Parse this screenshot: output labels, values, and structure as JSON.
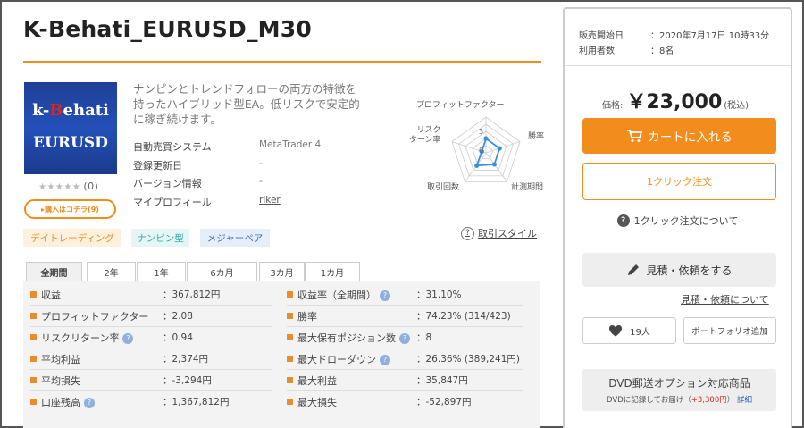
{
  "product": {
    "title": "K-Behati_EURUSD_M30",
    "image_line1_a": "k-",
    "image_line1_b": "B",
    "image_line1_c": "ehati",
    "image_line2": "EURUSD",
    "stars": "★★★★★",
    "review_count": "(0)",
    "buyers_button": "▸購入はコチラ(9)",
    "description": "ナンピンとトレンドフォローの両方の特徴を持ったハイブリッド型EA。低リスクで安定的に稼ぎ続けます。",
    "info": [
      {
        "label": "自動売買システム",
        "value": "MetaTrader 4"
      },
      {
        "label": "登録更新日",
        "value": "-"
      },
      {
        "label": "バージョン情報",
        "value": "-"
      },
      {
        "label": "マイプロフィール",
        "value": "riker"
      }
    ]
  },
  "radar": {
    "labels": {
      "profit_factor": "プロフィットファクター",
      "win_rate": "勝率",
      "period": "計測期間",
      "trades": "取引回数",
      "risk_return": "リスク\nターン率"
    },
    "scale_values": [
      "3",
      "0"
    ],
    "scores": [
      2,
      2,
      2,
      2.2,
      0.6
    ],
    "scale_max": 5
  },
  "tags": [
    "デイトレーディング",
    "ナンピン型",
    "メジャーペア"
  ],
  "trade_style_link": "取引スタイル",
  "tabs": [
    "全期間",
    "2年",
    "1年",
    "6カ月",
    "3カ月",
    "1カ月"
  ],
  "active_tab": "全期間",
  "stats_left": [
    {
      "label": "収益",
      "value": "：367,812円",
      "hint": false
    },
    {
      "label": "プロフィットファクター",
      "value": "：2.08",
      "hint": false
    },
    {
      "label": "リスクリターン率",
      "value": "：0.94",
      "hint": true
    },
    {
      "label": "平均利益",
      "value": "：2,374円",
      "hint": false
    },
    {
      "label": "平均損失",
      "value": "：-3,294円",
      "hint": false
    },
    {
      "label": "口座残高",
      "value": "：1,367,812円",
      "hint": true
    }
  ],
  "stats_right": [
    {
      "label": "収益率（全期間）",
      "value": "：31.10%",
      "hint": true
    },
    {
      "label": "勝率",
      "value": "：74.23% (314/423)",
      "hint": false
    },
    {
      "label": "最大保有ポジション数",
      "value": "：8",
      "hint": true
    },
    {
      "label": "最大ドローダウン",
      "value": "：26.36% (389,241円)",
      "hint": true
    },
    {
      "label": "最大利益",
      "value": "：35,847円",
      "hint": false
    },
    {
      "label": "最大損失",
      "value": "：-52,897円",
      "hint": false
    }
  ],
  "side": {
    "release_label": "販売開始日",
    "release_value": "：2020年7月17日 10時33分",
    "users_label": "利用者数",
    "users_value": "：8名",
    "price_label": "価格:",
    "price_value": "￥23,000",
    "price_tax": "(税込)",
    "cart_button": "カートに入れる",
    "oneclick_button": "1クリック注文",
    "about_oneclick": "1クリック注文について",
    "quote_button": "見積・依頼をする",
    "quote_link": "見積・依頼について",
    "favorites_count": "19人",
    "portfolio_button": "ポートフォリオ追加",
    "dvd_title": "DVD郵送オプション対応商品",
    "dvd_sub_a": "DVDに記録してお届け（",
    "dvd_sub_price": "+3,300円",
    "dvd_sub_b": "）",
    "dvd_detail": "詳細"
  },
  "colors": {
    "accent": "#f28c1d",
    "title_rule": "#f08c1a",
    "radar_line": "#3a8ee0",
    "brand_red": "#d9261c"
  }
}
